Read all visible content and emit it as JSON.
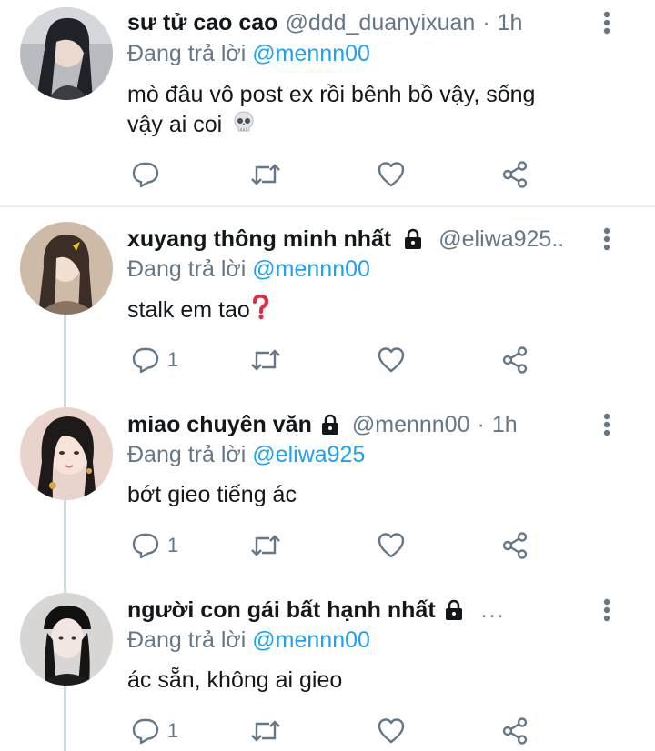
{
  "tweets": [
    {
      "name": "sư tử cao cao",
      "handle": "@ddd_duanyixuan",
      "time": "1h",
      "reply_prefix": "Đang trả lời",
      "reply_to": "@mennn00",
      "text_line1": "mò đâu vô post ex rồi bênh bồ vậy, sống",
      "text_line2": "vậy ai coi",
      "emoji": "skull",
      "reply_count": "",
      "locked": false
    },
    {
      "name": "xuyang thông minh nhất",
      "handle": "@eliwa925..",
      "reply_prefix": "Đang trả lời",
      "reply_to": "@mennn00",
      "text": "stalk em tao",
      "emoji": "red-question-mark",
      "reply_count": "1",
      "locked": true
    },
    {
      "name": "miao chuyên văn",
      "handle": "@mennn00",
      "time": "1h",
      "reply_prefix": "Đang trả lời",
      "reply_to": "@eliwa925",
      "text": "bớt gieo tiếng ác",
      "reply_count": "1",
      "locked": true
    },
    {
      "name": "người con gái bất hạnh nhất",
      "ellipsis": "...",
      "reply_prefix": "Đang trả lời",
      "reply_to": "@mennn00",
      "text": "ác sẵn, không ai gieo",
      "reply_count": "1",
      "locked": true
    }
  ],
  "colors": {
    "accent": "#1da1f2",
    "secondary_text": "#657786",
    "divider": "#e6ecf0",
    "thread_line": "#cfd9de"
  },
  "icons": [
    "reply-icon",
    "retweet-icon",
    "like-icon",
    "share-icon",
    "more-options-icon",
    "lock-icon"
  ]
}
